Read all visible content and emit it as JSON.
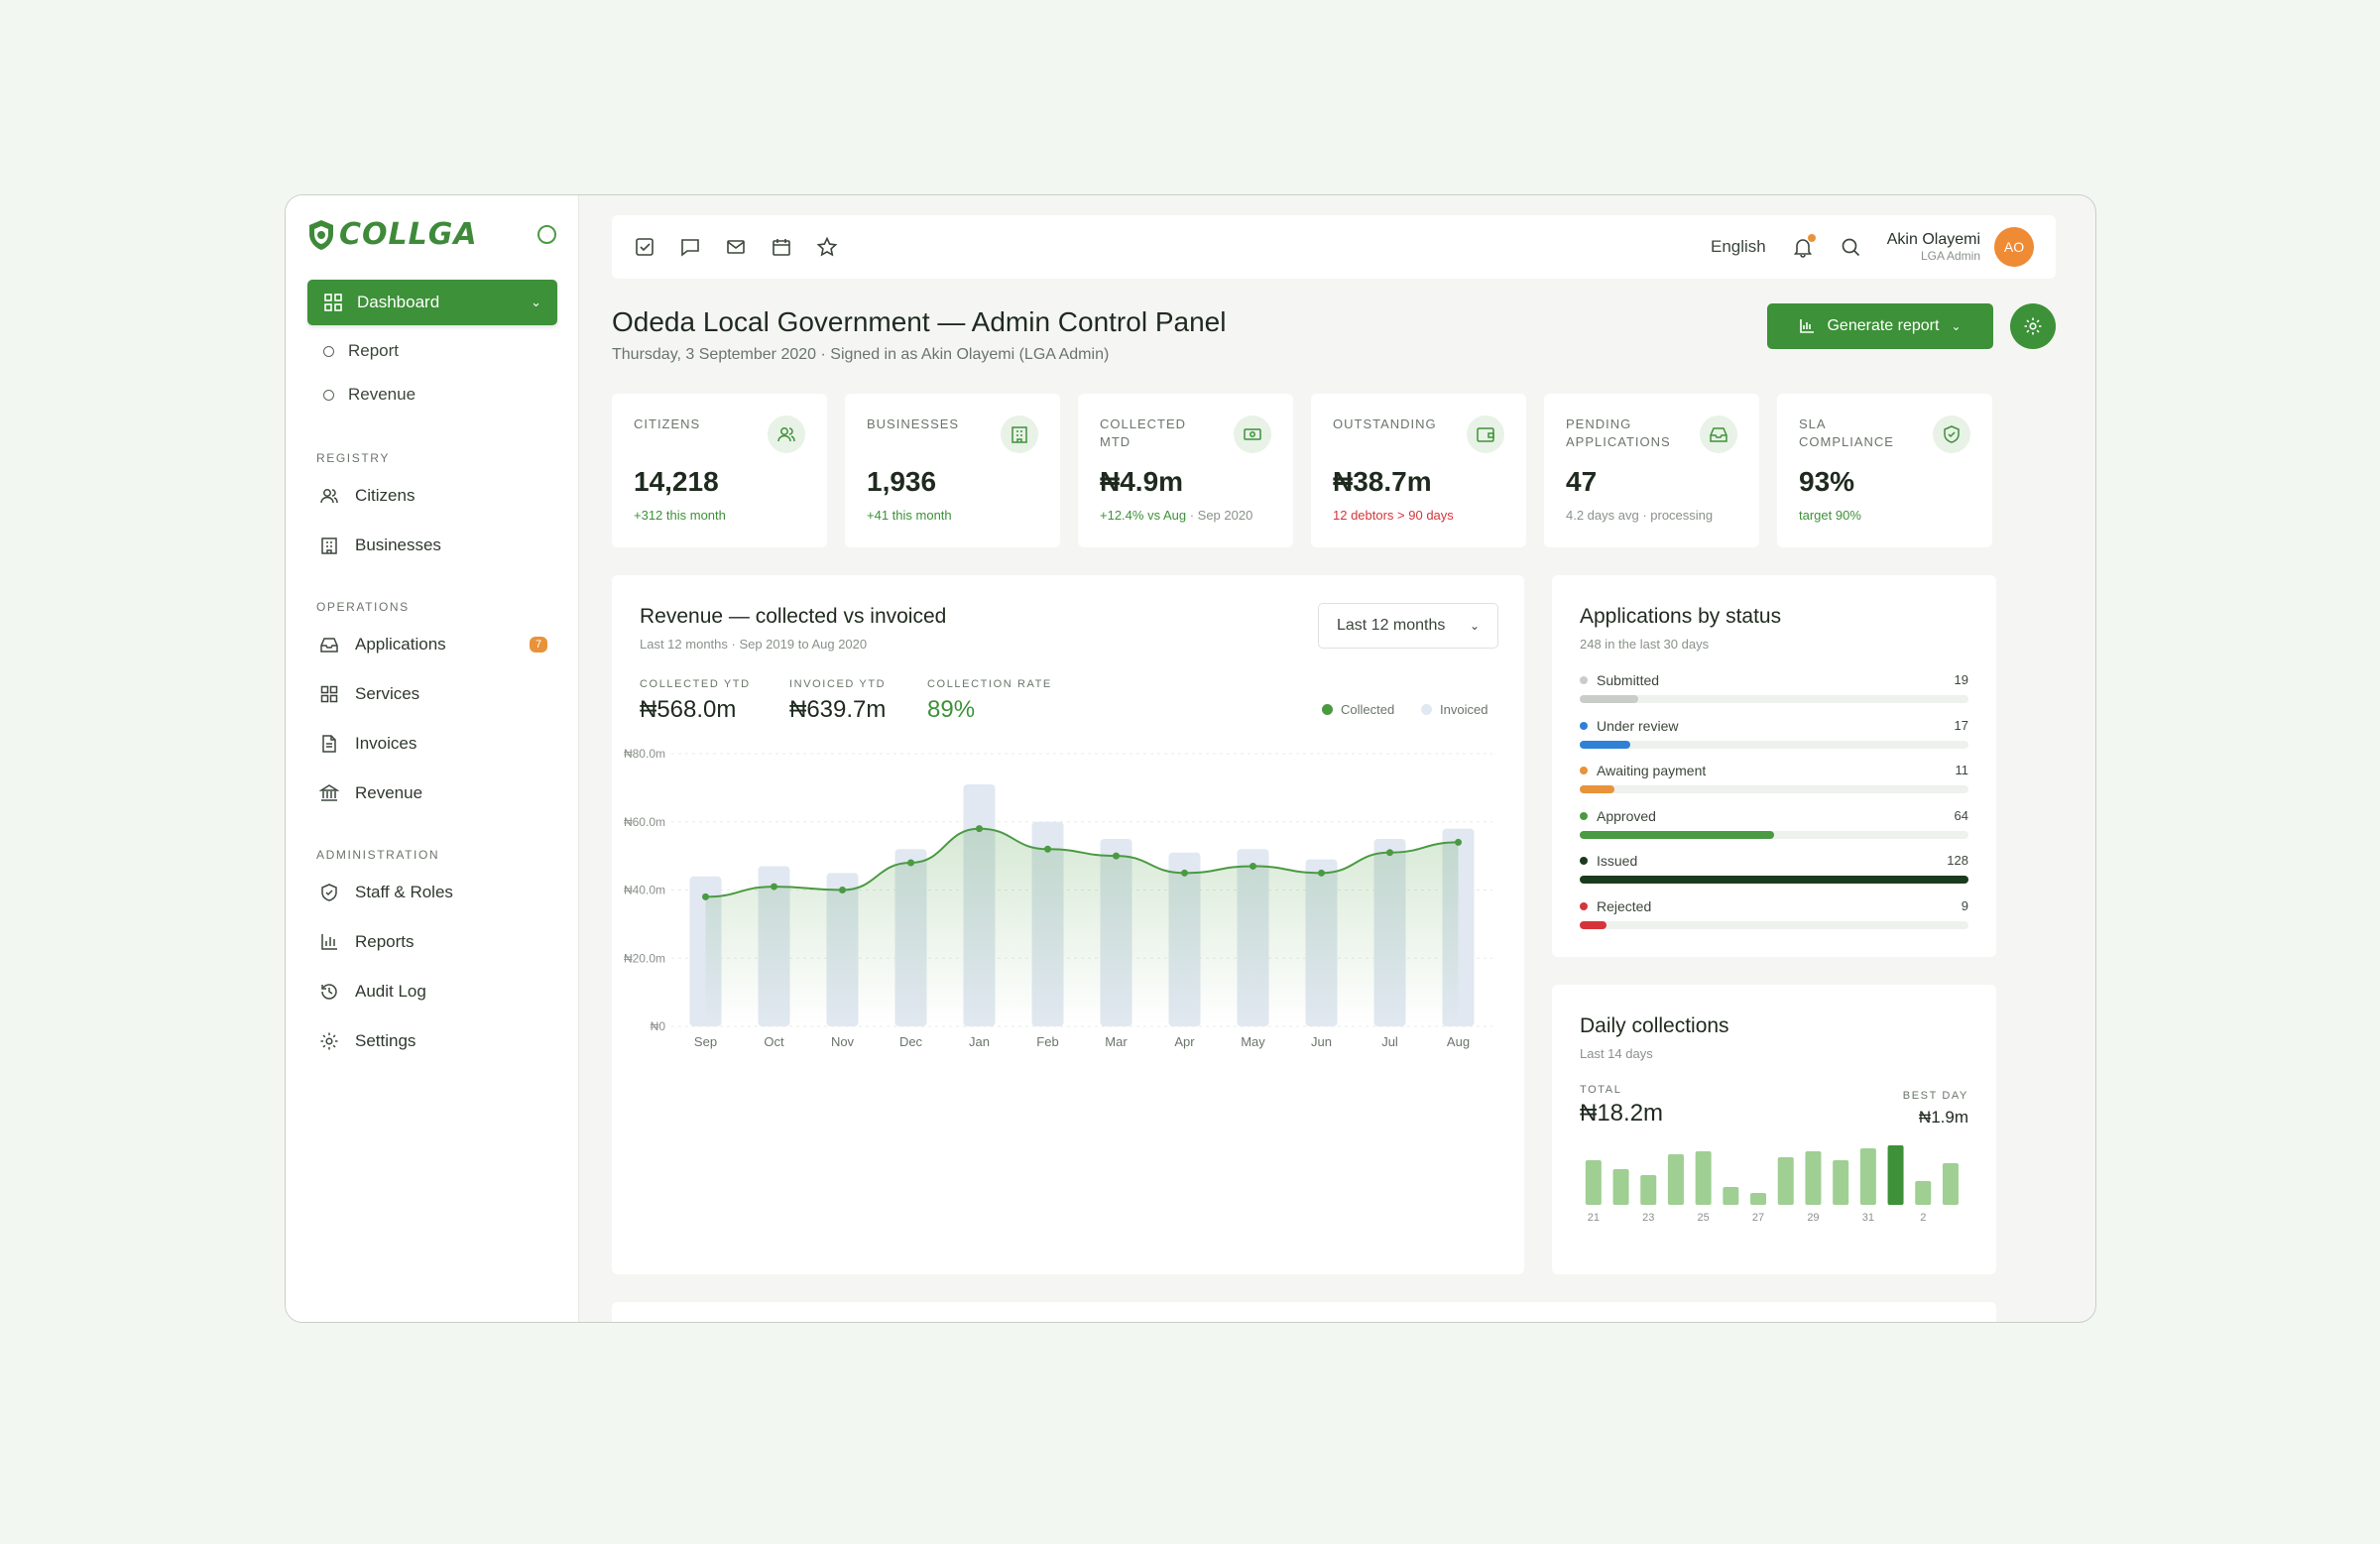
{
  "brand": {
    "name": "COLLGA"
  },
  "sidebar": {
    "active": {
      "label": "Dashboard"
    },
    "sub_items": [
      "Report",
      "Revenue"
    ],
    "sections": [
      {
        "label": "REGISTRY",
        "items": [
          {
            "label": "Citizens",
            "icon": "users-icon"
          },
          {
            "label": "Businesses",
            "icon": "building-icon"
          }
        ]
      },
      {
        "label": "OPERATIONS",
        "items": [
          {
            "label": "Applications",
            "icon": "inbox-icon",
            "badge": "7"
          },
          {
            "label": "Services",
            "icon": "grid-icon"
          },
          {
            "label": "Invoices",
            "icon": "document-icon"
          },
          {
            "label": "Revenue",
            "icon": "bank-icon"
          }
        ]
      },
      {
        "label": "ADMINISTRATION",
        "items": [
          {
            "label": "Staff & Roles",
            "icon": "shield-icon"
          },
          {
            "label": "Reports",
            "icon": "bar-chart-icon"
          },
          {
            "label": "Audit Log",
            "icon": "history-icon"
          },
          {
            "label": "Settings",
            "icon": "gear-icon"
          }
        ]
      }
    ]
  },
  "topbar": {
    "language": "English",
    "user_name": "Akin Olayemi",
    "user_role": "LGA Admin",
    "avatar_initials": "AO"
  },
  "page": {
    "title": "Odeda Local Government — Admin Control Panel",
    "subtitle": "Thursday, 3 September 2020 · Signed in as Akin Olayemi (LGA Admin)",
    "generate_label": "Generate report"
  },
  "kpis": [
    {
      "label": "CITIZENS",
      "value": "14,218",
      "note": "+312 this month",
      "note_color": "#3d9138"
    },
    {
      "label": "BUSINESSES",
      "value": "1,936",
      "note": "+41 this month",
      "note_color": "#3d9138"
    },
    {
      "label": "COLLECTED MTD",
      "value": "₦4.9m",
      "note": "+12.4% vs Aug",
      "note_extra": " · Sep 2020",
      "note_color": "#3d9138"
    },
    {
      "label": "OUTSTANDING",
      "value": "₦38.7m",
      "note": "12 debtors > 90 days",
      "note_color": "#d6343a"
    },
    {
      "label": "PENDING APPLICATIONS",
      "value": "47",
      "note": "4.2 days avg · processing",
      "note_color": "#8a918a"
    },
    {
      "label": "SLA COMPLIANCE",
      "value": "93%",
      "note": "target 90%",
      "note_color": "#3d9138"
    }
  ],
  "revenue": {
    "title": "Revenue — collected vs invoiced",
    "subtitle": "Last 12 months · Sep 2019 to Aug 2020",
    "range": "Last 12 months",
    "stats": [
      {
        "label": "COLLECTED YTD",
        "value": "₦568.0m"
      },
      {
        "label": "INVOICED YTD",
        "value": "₦639.7m"
      },
      {
        "label": "COLLECTION RATE",
        "value": "89%"
      }
    ],
    "legend": [
      "Collected",
      "Invoiced"
    ]
  },
  "chart_data": [
    {
      "type": "bar",
      "categories": [
        "Sep",
        "Oct",
        "Nov",
        "Dec",
        "Jan",
        "Feb",
        "Mar",
        "Apr",
        "May",
        "Jun",
        "Jul",
        "Aug"
      ],
      "series": [
        {
          "name": "Invoiced",
          "type": "bar",
          "values": [
            44,
            47,
            45,
            52,
            71,
            60,
            55,
            51,
            52,
            49,
            55,
            58
          ]
        },
        {
          "name": "Collected",
          "type": "line",
          "values": [
            38,
            41,
            40,
            48,
            58,
            52,
            50,
            45,
            47,
            45,
            51,
            54
          ]
        }
      ],
      "yticks": [
        "₦0",
        "₦20.0m",
        "₦40.0m",
        "₦60.0m",
        "₦80.0m"
      ],
      "ylim": [
        0,
        80
      ],
      "grid": true,
      "legend": "top-right"
    },
    {
      "type": "bar",
      "categories": [
        "21",
        "22",
        "23",
        "24",
        "25",
        "26",
        "27",
        "28",
        "29",
        "30",
        "31",
        "1",
        "2",
        "3"
      ],
      "tick_labels": [
        "21",
        "",
        "23",
        "",
        "25",
        "",
        "27",
        "",
        "29",
        "",
        "31",
        "",
        "2",
        ""
      ],
      "values": [
        1.5,
        1.2,
        1.0,
        1.7,
        1.8,
        0.6,
        0.4,
        1.6,
        1.8,
        1.5,
        1.9,
        2.0,
        0.8,
        1.4
      ],
      "highlight_index": 11
    }
  ],
  "applications": {
    "title": "Applications by status",
    "subtitle": "248 in the last 30 days",
    "rows": [
      {
        "label": "Submitted",
        "count": "19",
        "fraction": 0.15,
        "color": "#c9ccc8"
      },
      {
        "label": "Under review",
        "count": "17",
        "fraction": 0.13,
        "color": "#2f80d6"
      },
      {
        "label": "Awaiting payment",
        "count": "11",
        "fraction": 0.09,
        "color": "#e8923a"
      },
      {
        "label": "Approved",
        "count": "64",
        "fraction": 0.5,
        "color": "#4a9a42"
      },
      {
        "label": "Issued",
        "count": "128",
        "fraction": 1.0,
        "color": "#1b3a1d"
      },
      {
        "label": "Rejected",
        "count": "9",
        "fraction": 0.07,
        "color": "#d6343a"
      }
    ]
  },
  "daily": {
    "title": "Daily collections",
    "subtitle": "Last 14 days",
    "total_label": "TOTAL",
    "total_value": "₦18.2m",
    "best_label": "BEST DAY",
    "best_value": "₦1.9m"
  },
  "colors": {
    "accent": "#3d9138",
    "invoiced": "#e1e8f1",
    "collected": "#4a9a42"
  }
}
